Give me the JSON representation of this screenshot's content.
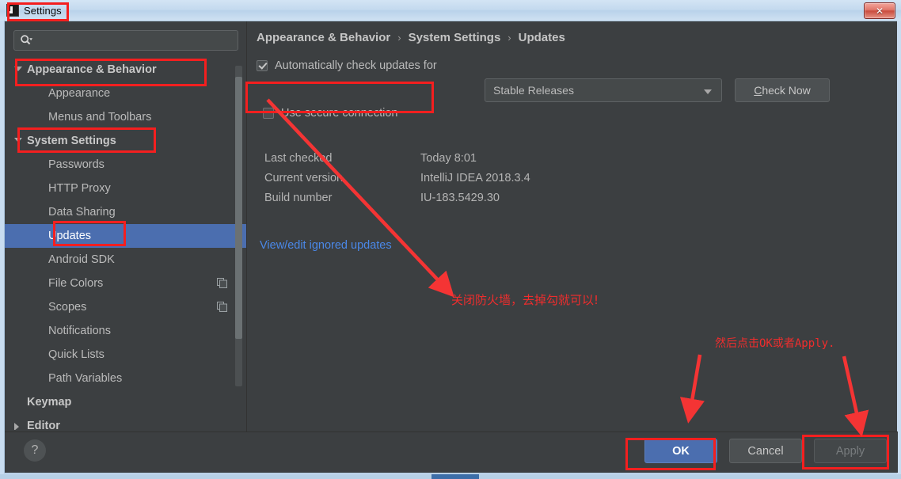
{
  "window": {
    "title": "Settings",
    "icon": "intellij-idea-icon",
    "close_label": "✕"
  },
  "sidebar": {
    "search": {
      "placeholder": "",
      "value": "",
      "icon": "search-icon"
    },
    "items": [
      {
        "label": "Appearance & Behavior",
        "level": 0,
        "arrow": "down",
        "selected": false,
        "copy": false
      },
      {
        "label": "Appearance",
        "level": 1,
        "arrow": "none",
        "selected": false,
        "copy": false
      },
      {
        "label": "Menus and Toolbars",
        "level": 1,
        "arrow": "none",
        "selected": false,
        "copy": false
      },
      {
        "label": "System Settings",
        "level": 0,
        "arrow": "down",
        "selected": false,
        "copy": false
      },
      {
        "label": "Passwords",
        "level": 1,
        "arrow": "none",
        "selected": false,
        "copy": false
      },
      {
        "label": "HTTP Proxy",
        "level": 1,
        "arrow": "none",
        "selected": false,
        "copy": false
      },
      {
        "label": "Data Sharing",
        "level": 1,
        "arrow": "none",
        "selected": false,
        "copy": false
      },
      {
        "label": "Updates",
        "level": 1,
        "arrow": "none",
        "selected": true,
        "copy": false
      },
      {
        "label": "Android SDK",
        "level": 1,
        "arrow": "none",
        "selected": false,
        "copy": false
      },
      {
        "label": "File Colors",
        "level": 1,
        "arrow": "none",
        "selected": false,
        "copy": true
      },
      {
        "label": "Scopes",
        "level": 1,
        "arrow": "none",
        "selected": false,
        "copy": true
      },
      {
        "label": "Notifications",
        "level": 1,
        "arrow": "none",
        "selected": false,
        "copy": false
      },
      {
        "label": "Quick Lists",
        "level": 1,
        "arrow": "none",
        "selected": false,
        "copy": false
      },
      {
        "label": "Path Variables",
        "level": 1,
        "arrow": "none",
        "selected": false,
        "copy": false
      },
      {
        "label": "Keymap",
        "level": 0,
        "arrow": "none",
        "selected": false,
        "copy": false
      },
      {
        "label": "Editor",
        "level": 0,
        "arrow": "right",
        "selected": false,
        "copy": false
      }
    ]
  },
  "main": {
    "breadcrumbs": [
      "Appearance & Behavior",
      "System Settings",
      "Updates"
    ],
    "breadcrumb_separator": "›",
    "auto_check": {
      "label": "Automatically check updates for",
      "checked": true,
      "channel": "Stable Releases",
      "check_now": "Check Now",
      "check_now_mnemonic": "C"
    },
    "secure_connection": {
      "label": "Use secure connection",
      "checked": false
    },
    "info_rows": [
      {
        "key": "Last checked",
        "value": "Today 8:01"
      },
      {
        "key": "Current version",
        "value": "IntelliJ IDEA 2018.3.4"
      },
      {
        "key": "Build number",
        "value": "IU-183.5429.30"
      }
    ],
    "ignored_link": "View/edit ignored updates"
  },
  "footer": {
    "help": "?",
    "ok": "OK",
    "cancel": "Cancel",
    "apply": "Apply"
  },
  "annotations": {
    "note_firewall": "关闭防火墙，去掉勾就可以!",
    "note_confirm": "然后点击OK或者Apply.",
    "highlight_color": "#f41f1f",
    "arrow_color": "#f43434"
  },
  "colors": {
    "panel_bg": "#3c3f41",
    "selection": "#4b6eaf",
    "text": "#bbbbbb",
    "link": "#4a88e8",
    "annotation_red": "#ef2d2d"
  }
}
